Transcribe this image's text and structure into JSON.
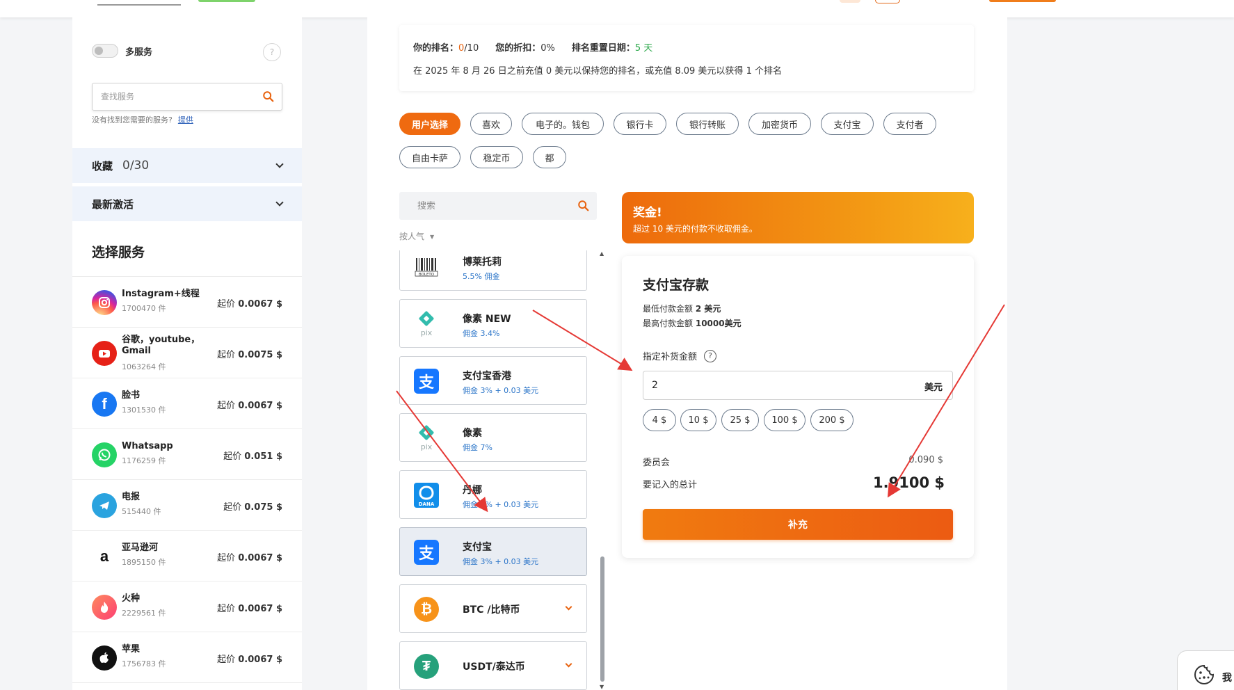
{
  "sidebar": {
    "multi_service_label": "多服务",
    "help_icon": "?",
    "search_placeholder": "查找服务",
    "not_found_text": "没有找到您需要的服务?",
    "not_found_link": "提供",
    "favorites_title": "收藏",
    "favorites_count": "0/30",
    "recent_title": "最新激活",
    "select_title": "选择服务",
    "services": [
      {
        "name": "Instagram+线程",
        "count": "1700470 件",
        "price_prefix": "起价",
        "price": "0.0067 $",
        "icon": "instagram-icon",
        "color": "#d62976"
      },
      {
        "name": "谷歌，youtube，Gmail",
        "count": "1063264 件",
        "price_prefix": "起价",
        "price": "0.0075 $",
        "icon": "youtube-icon",
        "color": "#e62117"
      },
      {
        "name": "脸书",
        "count": "1301530 件",
        "price_prefix": "起价",
        "price": "0.0067 $",
        "icon": "facebook-icon",
        "color": "#1877f2"
      },
      {
        "name": "Whatsapp",
        "count": "1176259 件",
        "price_prefix": "起价",
        "price": "0.051 $",
        "icon": "whatsapp-icon",
        "color": "#25d366"
      },
      {
        "name": "电报",
        "count": "515440 件",
        "price_prefix": "起价",
        "price": "0.075 $",
        "icon": "telegram-icon",
        "color": "#2aa3df"
      },
      {
        "name": "亚马逊河",
        "count": "1895150 件",
        "price_prefix": "起价",
        "price": "0.0067 $",
        "icon": "amazon-icon",
        "color": "#ffffff"
      },
      {
        "name": "火种",
        "count": "2229561 件",
        "price_prefix": "起价",
        "price": "0.0067 $",
        "icon": "tinder-icon",
        "color": "#fd4e6a"
      },
      {
        "name": "苹果",
        "count": "1756783 件",
        "price_prefix": "起价",
        "price": "0.0067 $",
        "icon": "apple-icon",
        "color": "#111111"
      }
    ]
  },
  "rank": {
    "rank_label": "你的排名：",
    "rank_value": "0",
    "rank_total": "/10",
    "discount_label": "您的折扣：",
    "discount_value": "0%",
    "reset_label": "排名重置日期：",
    "reset_value": "5 天",
    "note": "在 2025 年 8 月 26 日之前充值 0 美元以保持您的排名，或充值 8.09 美元以获得 1 个排名"
  },
  "chips": [
    "用户选择",
    "喜欢",
    "电子的。钱包",
    "银行卡",
    "银行转账",
    "加密货币",
    "支付宝",
    "支付者",
    "自由卡萨",
    "稳定币",
    "都"
  ],
  "methods": {
    "search_placeholder": "搜索",
    "sort_label": "按人气",
    "items": [
      {
        "name": "博莱托莉",
        "fee": "5.5% 佣金",
        "icon": "boleto-icon"
      },
      {
        "name": "像素 NEW",
        "fee": "佣金 3.4%",
        "icon": "pix-icon"
      },
      {
        "name": "支付宝香港",
        "fee": "佣金 3% + 0.03 美元",
        "icon": "alipay-icon"
      },
      {
        "name": "像素",
        "fee": "佣金 7%",
        "icon": "pix-icon"
      },
      {
        "name": "丹娜",
        "fee": "佣金 3% + 0.03 美元",
        "icon": "dana-icon"
      },
      {
        "name": "支付宝",
        "fee": "佣金 3% + 0.03 美元",
        "icon": "alipay-icon"
      },
      {
        "name": "BTC /比特币",
        "fee": "",
        "icon": "bitcoin-icon"
      },
      {
        "name": "USDT/泰达币",
        "fee": "",
        "icon": "tether-icon"
      }
    ]
  },
  "bonus": {
    "title": "奖金!",
    "subtitle": "超过 10 美元的付款不收取佣金。"
  },
  "deposit": {
    "title": "支付宝存款",
    "min_label": "最低付款金额",
    "min_value": "2 美元",
    "max_label": "最高付款金额",
    "max_value": "10000美元",
    "amount_label": "指定补货金额",
    "amount_value": "2",
    "amount_unit": "美元",
    "quick_amounts": [
      "4 $",
      "10 $",
      "25 $",
      "100 $",
      "200 $"
    ],
    "commission_label": "委员会",
    "commission_value": "0.090 $",
    "total_label": "要记入的总计",
    "total_value": "1.9100 $",
    "topup_label": "补充"
  },
  "cookie": {
    "text": "我"
  },
  "colors": {
    "accent": "#ef6a10",
    "link": "#2a74c8",
    "arrow": "#e53935"
  }
}
